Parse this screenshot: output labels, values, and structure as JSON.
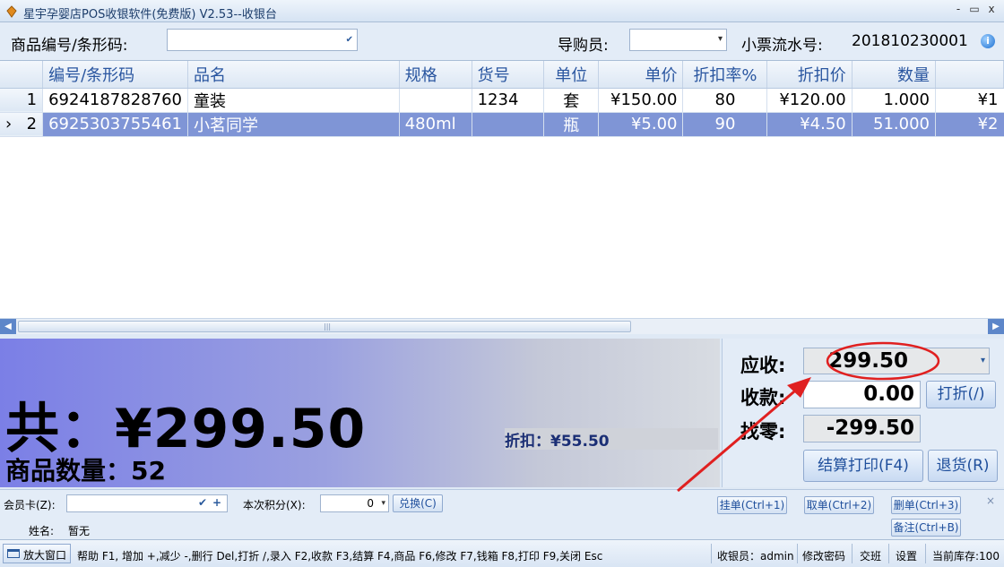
{
  "window": {
    "title": "星宇孕婴店POS收银软件(免费版) V2.53--收银台",
    "min_glyph": "-",
    "restore_glyph": "▭",
    "close_glyph": "x"
  },
  "search": {
    "product_code_label": "商品编号/条形码:",
    "product_code_value": "",
    "guide_label": "导购员:",
    "guide_value": "",
    "receipt_label": "小票流水号:",
    "receipt_no": "201810230001",
    "help_glyph": "i"
  },
  "grid": {
    "columns": [
      "编号/条形码",
      "品名",
      "规格",
      "货号",
      "单位",
      "单价",
      "折扣率%",
      "折扣价",
      "数量",
      ""
    ],
    "rows": [
      {
        "indicator": "",
        "no": "1",
        "code": "6924187828760",
        "name": "童装",
        "spec": "",
        "item_no": "1234",
        "unit": "套",
        "price": "¥150.00",
        "rate": "80",
        "disc_price": "¥120.00",
        "qty": "1.000",
        "subtotal": "¥1"
      },
      {
        "indicator": "›",
        "no": "2",
        "code": "6925303755461",
        "name": "小茗同学",
        "spec": "480ml",
        "item_no": "",
        "unit": "瓶",
        "price": "¥5.00",
        "rate": "90",
        "disc_price": "¥4.50",
        "qty": "51.000",
        "subtotal": "¥2"
      }
    ],
    "scroll_left_glyph": "◀",
    "scroll_right_glyph": "▶",
    "grip_glyph": "|||"
  },
  "totals": {
    "total_text": "共：¥299.50",
    "quantity_text": "商品数量：52",
    "discount_text": "折扣：¥55.50"
  },
  "payment": {
    "receivable_label": "应收:",
    "receivable_value": "299.50",
    "received_label": "收款:",
    "received_value": "0.00",
    "change_label": "找零:",
    "change_value": "-299.50",
    "discount_button": "打折(/)",
    "checkout_button": "结算打印(F4)",
    "return_button": "退货(R)"
  },
  "member": {
    "card_label": "会员卡(Z):",
    "card_value": "",
    "points_label": "本次积分(X):",
    "points_value": "0",
    "exchange_button": "兑换(C)",
    "name_label": "姓名:",
    "name_value": "暂无",
    "hold_button": "挂单(Ctrl+1)",
    "retrieve_button": "取单(Ctrl+2)",
    "delete_button": "删单(Ctrl+3)",
    "note_button": "备注(Ctrl+B)",
    "close_glyph": "×"
  },
  "status": {
    "enlarge": "放大窗口",
    "shortcuts": "帮助 F1, 增加 +,减少 -,删行 Del,打折 /,录入 F2,收款 F3,结算 F4,商品 F6,修改 F7,钱箱 F8,打印 F9,关闭 Esc",
    "cashier": "收银员：admin",
    "change_password": "修改密码",
    "shift": "交班",
    "settings": "设置",
    "stock": "当前库存:100"
  },
  "colors": {
    "selected_row": "#7f95d6",
    "annotation": "#e02020",
    "header_text": "#2a56a0"
  }
}
